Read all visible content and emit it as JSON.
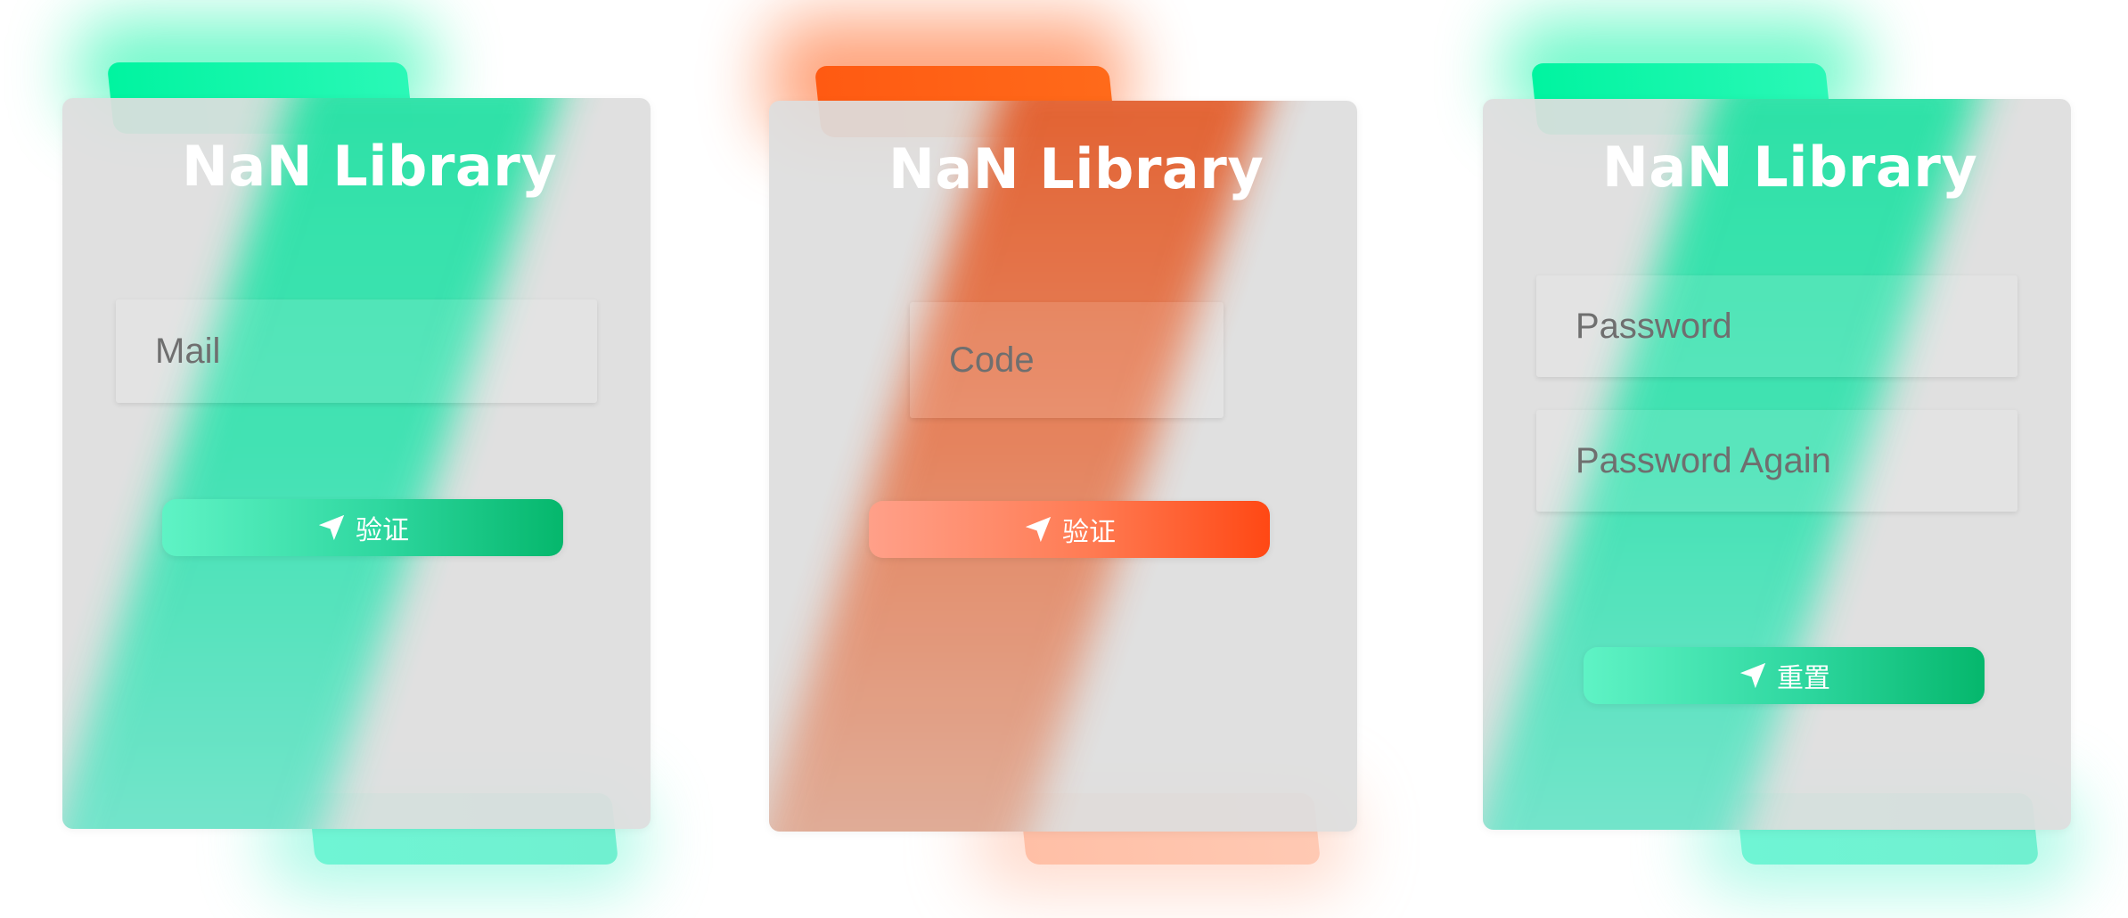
{
  "cards": [
    {
      "title": "NaN Library",
      "fields": [
        {
          "placeholder": "Mail",
          "value": ""
        }
      ],
      "button": {
        "label": "验证",
        "icon": "send-icon"
      },
      "theme": "green"
    },
    {
      "title": "NaN Library",
      "fields": [
        {
          "placeholder": "Code",
          "value": ""
        }
      ],
      "button": {
        "label": "验证",
        "icon": "send-icon"
      },
      "theme": "orange"
    },
    {
      "title": "NaN Library",
      "fields": [
        {
          "placeholder": "Password",
          "value": ""
        },
        {
          "placeholder": "Password Again",
          "value": ""
        }
      ],
      "button": {
        "label": "重置",
        "icon": "send-icon"
      },
      "theme": "green"
    }
  ],
  "colors": {
    "green_top": "#00f4a0",
    "green_bottom": "#6ff5d4",
    "green_button_start": "#5ff3c5",
    "green_button_end": "#05b76c",
    "orange_top": "#ff5a12",
    "orange_bottom": "#ffbfa6",
    "orange_button_start": "#ffa089",
    "orange_button_end": "#ff4814",
    "card_bg": "#e1e1e1",
    "title_text": "#ffffff",
    "placeholder_text": "#6f6f6f"
  }
}
